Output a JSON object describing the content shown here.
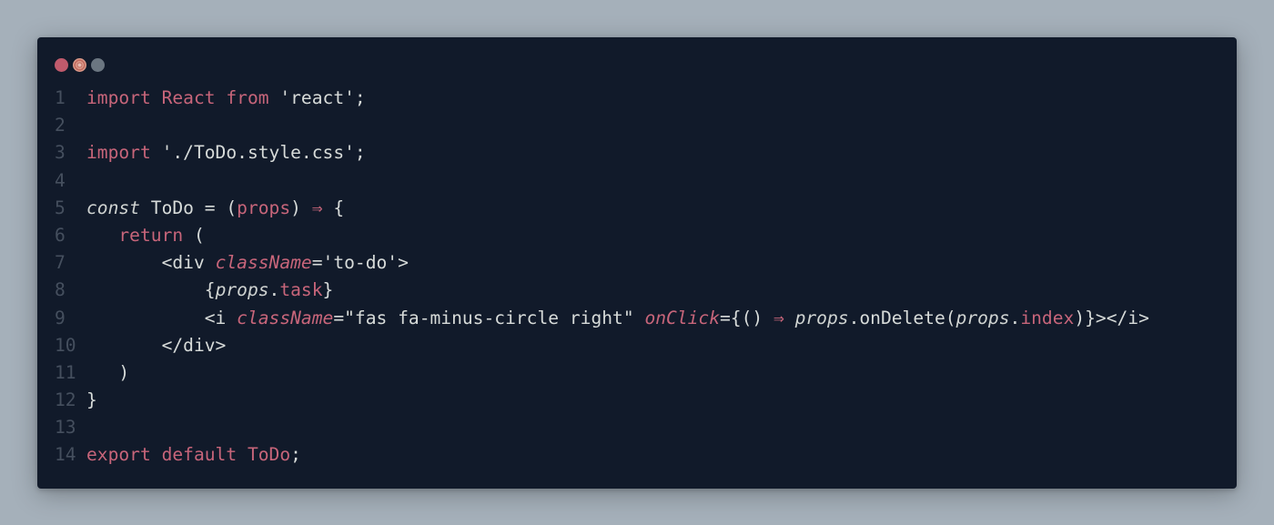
{
  "window": {
    "controls": [
      "close",
      "minimize",
      "maximize"
    ]
  },
  "colors": {
    "background": "#a5b0ba",
    "editor": "#111a2a",
    "keyword": "#c7657a",
    "text": "#d7dbd9",
    "line_number": "#454f5e"
  },
  "code": {
    "lines": [
      {
        "n": "1",
        "tokens": [
          {
            "t": "import",
            "c": "kw"
          },
          {
            "t": " ",
            "c": "txt"
          },
          {
            "t": "React",
            "c": "id"
          },
          {
            "t": " ",
            "c": "txt"
          },
          {
            "t": "from",
            "c": "kw"
          },
          {
            "t": " 'react';",
            "c": "str"
          }
        ]
      },
      {
        "n": "2",
        "tokens": []
      },
      {
        "n": "3",
        "tokens": [
          {
            "t": "import",
            "c": "kw"
          },
          {
            "t": " './ToDo.style.css';",
            "c": "str"
          }
        ]
      },
      {
        "n": "4",
        "tokens": []
      },
      {
        "n": "5",
        "tokens": [
          {
            "t": "const",
            "c": "it"
          },
          {
            "t": " ToDo = (",
            "c": "txt"
          },
          {
            "t": "props",
            "c": "param"
          },
          {
            "t": ") ",
            "c": "txt"
          },
          {
            "t": "⇒",
            "c": "arrow"
          },
          {
            "t": " {",
            "c": "txt"
          }
        ]
      },
      {
        "n": "6",
        "tokens": [
          {
            "t": "   ",
            "c": "txt"
          },
          {
            "t": "return",
            "c": "kw"
          },
          {
            "t": " (",
            "c": "txt"
          }
        ]
      },
      {
        "n": "7",
        "tokens": [
          {
            "t": "       <div ",
            "c": "txt"
          },
          {
            "t": "className",
            "c": "attr"
          },
          {
            "t": "='to-do'>",
            "c": "txt"
          }
        ]
      },
      {
        "n": "8",
        "tokens": [
          {
            "t": "           {",
            "c": "txt"
          },
          {
            "t": "props",
            "c": "props"
          },
          {
            "t": ".",
            "c": "txt"
          },
          {
            "t": "task",
            "c": "prop"
          },
          {
            "t": "}",
            "c": "txt"
          }
        ]
      },
      {
        "n": "9",
        "tokens": [
          {
            "t": "           <i ",
            "c": "txt"
          },
          {
            "t": "className",
            "c": "attr"
          },
          {
            "t": "=\"fas fa-minus-circle right\" ",
            "c": "txt"
          },
          {
            "t": "onClick",
            "c": "attr"
          },
          {
            "t": "={() ",
            "c": "txt"
          },
          {
            "t": "⇒",
            "c": "arrow"
          },
          {
            "t": " ",
            "c": "txt"
          },
          {
            "t": "props",
            "c": "props"
          },
          {
            "t": ".onDelete(",
            "c": "txt"
          },
          {
            "t": "props",
            "c": "props"
          },
          {
            "t": ".",
            "c": "txt"
          },
          {
            "t": "index",
            "c": "prop"
          },
          {
            "t": ")}></i>",
            "c": "txt"
          }
        ]
      },
      {
        "n": "10",
        "tokens": [
          {
            "t": "       </div>",
            "c": "txt"
          }
        ]
      },
      {
        "n": "11",
        "tokens": [
          {
            "t": "   )",
            "c": "txt"
          }
        ]
      },
      {
        "n": "12",
        "tokens": [
          {
            "t": "}",
            "c": "txt"
          }
        ]
      },
      {
        "n": "13",
        "tokens": []
      },
      {
        "n": "14",
        "tokens": [
          {
            "t": "export",
            "c": "kw"
          },
          {
            "t": " ",
            "c": "txt"
          },
          {
            "t": "default",
            "c": "kw"
          },
          {
            "t": " ",
            "c": "txt"
          },
          {
            "t": "ToDo",
            "c": "id"
          },
          {
            "t": ";",
            "c": "txt"
          }
        ]
      }
    ]
  }
}
